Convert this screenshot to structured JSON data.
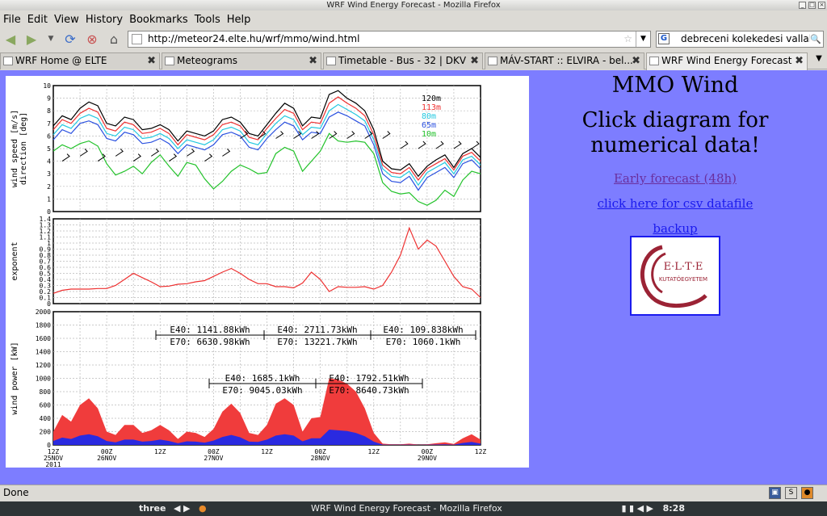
{
  "window": {
    "title": "WRF Wind Energy Forecast - Mozilla Firefox"
  },
  "menu": [
    "File",
    "Edit",
    "View",
    "History",
    "Bookmarks",
    "Tools",
    "Help"
  ],
  "nav": {
    "url": "http://meteor24.elte.hu/wrf/mmo/wind.html",
    "search_value": "debreceni kolekedesi vallalat"
  },
  "tabs": [
    {
      "label": "WRF Home @ ELTE"
    },
    {
      "label": "Meteograms"
    },
    {
      "label": "Timetable - Bus - 32 | DKV"
    },
    {
      "label": "MÁV-START :: ELVIRA - bel..."
    },
    {
      "label": "WRF Wind Energy Forecast",
      "active": true
    }
  ],
  "page": {
    "heading": "MMO Wind",
    "instruction_line1": "Click diagram for",
    "instruction_line2": "numerical data!",
    "link_early": "Early forecast (48h)",
    "link_csv": "click here for csv datafile",
    "link_backup": "backup",
    "logo_text": "E·L·T·E",
    "logo_sub": "KUTATÓEGYETEM"
  },
  "status": {
    "text": "Done"
  },
  "taskbar": {
    "workspace": "three",
    "task_title": "WRF Wind Energy Forecast - Mozilla Firefox",
    "clock": "8:28"
  },
  "colors": {
    "page_bg": "#7d7dff",
    "power_red": "#f03c3c",
    "power_blue": "#2a2ae0",
    "speed_green": "#22c22a"
  },
  "chart_data": [
    {
      "type": "line",
      "ylabel": "wind speed [m/s]\ndirection [deg]",
      "ylim": [
        0,
        10
      ],
      "x_ticks": [
        "12Z\n25NOV\n2011",
        "00Z\n26NOV",
        "12Z",
        "00Z\n27NOV",
        "12Z",
        "00Z\n28NOV",
        "12Z",
        "00Z\n29NOV",
        "12Z"
      ],
      "x": [
        0,
        1,
        2,
        3,
        4,
        5,
        6,
        7,
        8,
        9,
        10,
        11,
        12,
        13,
        14,
        15,
        16,
        17,
        18,
        19,
        20,
        21,
        22,
        23,
        24,
        25,
        26,
        27,
        28,
        29,
        30,
        31,
        32,
        33,
        34,
        35,
        36,
        37,
        38,
        39,
        40,
        41,
        42,
        43,
        44,
        45,
        46,
        47,
        48
      ],
      "series": [
        {
          "name": "120m",
          "color": "#000000",
          "values": [
            6.8,
            7.6,
            7.3,
            8.2,
            8.7,
            8.4,
            7.0,
            6.8,
            7.5,
            7.3,
            6.5,
            6.6,
            6.9,
            6.5,
            5.6,
            6.4,
            6.2,
            6.0,
            6.4,
            7.3,
            7.5,
            7.1,
            6.2,
            6.0,
            6.9,
            7.8,
            8.6,
            8.2,
            6.8,
            7.5,
            7.4,
            9.3,
            9.6,
            9.0,
            8.6,
            8.0,
            6.5,
            4.0,
            3.4,
            3.3,
            3.8,
            2.8,
            3.6,
            4.1,
            4.5,
            3.5,
            4.6,
            5.0,
            4.3
          ]
        },
        {
          "name": "113m",
          "color": "#ee3030",
          "values": [
            6.5,
            7.3,
            7.0,
            7.8,
            8.2,
            7.9,
            6.6,
            6.4,
            7.1,
            6.9,
            6.2,
            6.3,
            6.6,
            6.2,
            5.3,
            6.1,
            5.9,
            5.7,
            6.1,
            6.9,
            7.1,
            6.8,
            5.9,
            5.7,
            6.6,
            7.4,
            8.1,
            7.8,
            6.5,
            7.1,
            7.0,
            8.6,
            9.1,
            8.6,
            8.2,
            7.6,
            6.1,
            3.7,
            3.1,
            3.0,
            3.5,
            2.5,
            3.4,
            3.8,
            4.2,
            3.3,
            4.4,
            4.7,
            4.0
          ]
        },
        {
          "name": "80m",
          "color": "#22c8e0",
          "values": [
            6.1,
            6.9,
            6.6,
            7.4,
            7.7,
            7.4,
            6.2,
            6.0,
            6.7,
            6.5,
            5.8,
            5.9,
            6.2,
            5.8,
            5.0,
            5.7,
            5.5,
            5.3,
            5.7,
            6.5,
            6.7,
            6.4,
            5.5,
            5.3,
            6.2,
            7.0,
            7.6,
            7.3,
            6.1,
            6.7,
            6.6,
            8.0,
            8.5,
            8.1,
            7.7,
            7.2,
            5.7,
            3.4,
            2.8,
            2.7,
            3.2,
            2.1,
            3.1,
            3.5,
            3.9,
            3.0,
            4.1,
            4.4,
            3.7
          ]
        },
        {
          "name": "65m",
          "color": "#2a50e0",
          "values": [
            5.7,
            6.5,
            6.2,
            7.0,
            7.2,
            6.9,
            5.8,
            5.6,
            6.3,
            6.1,
            5.4,
            5.5,
            5.8,
            5.4,
            4.6,
            5.3,
            5.1,
            4.9,
            5.3,
            6.1,
            6.3,
            6.0,
            5.1,
            4.9,
            5.8,
            6.5,
            7.1,
            6.8,
            5.7,
            6.3,
            6.2,
            7.5,
            7.9,
            7.6,
            7.2,
            6.8,
            5.3,
            3.0,
            2.4,
            2.3,
            2.8,
            1.7,
            2.7,
            3.1,
            3.5,
            2.7,
            3.8,
            4.1,
            3.4
          ]
        },
        {
          "name": "10m",
          "color": "#22c22a",
          "values": [
            4.8,
            5.3,
            5.0,
            5.4,
            5.6,
            5.2,
            3.8,
            2.9,
            3.2,
            3.6,
            3.0,
            3.9,
            4.5,
            3.6,
            2.8,
            3.9,
            3.7,
            2.6,
            1.8,
            2.4,
            3.2,
            3.7,
            3.4,
            3.0,
            3.1,
            4.6,
            5.1,
            4.8,
            3.2,
            4.0,
            4.8,
            6.2,
            5.6,
            5.5,
            5.6,
            5.5,
            4.6,
            2.3,
            1.6,
            1.4,
            1.5,
            0.8,
            0.5,
            0.9,
            1.7,
            1.2,
            2.5,
            3.2,
            3.0
          ]
        }
      ]
    },
    {
      "type": "line",
      "ylabel": "exponent",
      "ylim": [
        0,
        1.4
      ],
      "y_ticks": [
        "0",
        "0.1",
        "0.2",
        "0.3",
        "0.4",
        "0.5",
        "0.6",
        "0.7",
        "0.8",
        "0.9",
        "1",
        "1.1",
        "1.2",
        "1.3",
        "1.4"
      ],
      "x": [
        0,
        1,
        2,
        3,
        4,
        5,
        6,
        7,
        8,
        9,
        10,
        11,
        12,
        13,
        14,
        15,
        16,
        17,
        18,
        19,
        20,
        21,
        22,
        23,
        24,
        25,
        26,
        27,
        28,
        29,
        30,
        31,
        32,
        33,
        34,
        35,
        36,
        37,
        38,
        39,
        40,
        41,
        42,
        43,
        44,
        45,
        46,
        47,
        48
      ],
      "series": [
        {
          "color": "#ee3030",
          "values": [
            0.17,
            0.22,
            0.24,
            0.24,
            0.24,
            0.25,
            0.25,
            0.3,
            0.4,
            0.5,
            0.43,
            0.36,
            0.28,
            0.29,
            0.32,
            0.33,
            0.36,
            0.38,
            0.45,
            0.52,
            0.58,
            0.5,
            0.4,
            0.33,
            0.33,
            0.28,
            0.28,
            0.26,
            0.34,
            0.52,
            0.4,
            0.2,
            0.28,
            0.27,
            0.27,
            0.28,
            0.24,
            0.3,
            0.52,
            0.8,
            1.25,
            0.9,
            1.05,
            0.95,
            0.7,
            0.45,
            0.28,
            0.24,
            0.1
          ]
        }
      ]
    },
    {
      "type": "area",
      "ylabel": "wind power [kW]",
      "ylim": [
        0,
        2000
      ],
      "y_ticks": [
        "0",
        "200",
        "400",
        "600",
        "800",
        "1000",
        "1200",
        "1400",
        "1600",
        "1800",
        "2000"
      ],
      "x": [
        0,
        1,
        2,
        3,
        4,
        5,
        6,
        7,
        8,
        9,
        10,
        11,
        12,
        13,
        14,
        15,
        16,
        17,
        18,
        19,
        20,
        21,
        22,
        23,
        24,
        25,
        26,
        27,
        28,
        29,
        30,
        31,
        32,
        33,
        34,
        35,
        36,
        37,
        38,
        39,
        40,
        41,
        42,
        43,
        44,
        45,
        46,
        47,
        48
      ],
      "series": [
        {
          "name": "E70",
          "color": "#f03c3c",
          "values": [
            200,
            450,
            350,
            600,
            700,
            550,
            200,
            150,
            300,
            300,
            180,
            220,
            300,
            220,
            90,
            200,
            180,
            120,
            240,
            500,
            620,
            480,
            180,
            150,
            300,
            620,
            700,
            600,
            200,
            400,
            420,
            1000,
            980,
            920,
            800,
            550,
            180,
            20,
            10,
            8,
            20,
            5,
            8,
            25,
            40,
            15,
            100,
            160,
            80
          ]
        },
        {
          "name": "E40",
          "color": "#2a2ae0",
          "values": [
            60,
            110,
            90,
            140,
            160,
            130,
            60,
            40,
            80,
            80,
            50,
            60,
            80,
            60,
            25,
            55,
            50,
            35,
            65,
            120,
            150,
            115,
            50,
            45,
            80,
            140,
            160,
            140,
            55,
            100,
            100,
            230,
            220,
            210,
            180,
            130,
            50,
            5,
            3,
            2,
            5,
            1,
            2,
            6,
            10,
            4,
            30,
            45,
            20
          ]
        }
      ],
      "annotations": [
        {
          "lines": [
            "E40: 1141.88kWh",
            "E70: 6630.98kWh"
          ]
        },
        {
          "lines": [
            "E40: 2711.73kWh",
            "E70: 13221.7kWh"
          ]
        },
        {
          "lines": [
            "E40: 109.838kWh",
            "E70: 1060.1kWh"
          ]
        },
        {
          "lines": [
            "E40: 1685.1kWh",
            "E70: 9045.03kWh"
          ]
        },
        {
          "lines": [
            "E40: 1792.51kWh",
            "E70: 8640.73kWh"
          ]
        }
      ]
    }
  ]
}
